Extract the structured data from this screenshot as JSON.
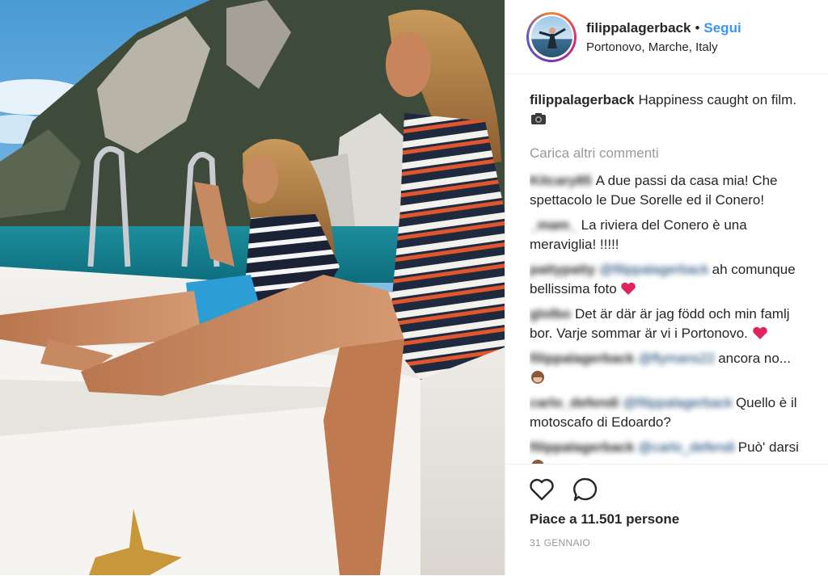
{
  "post": {
    "username": "filippalagerback",
    "follow_label": "Segui",
    "separator": "•",
    "location": "Portonovo, Marche, Italy",
    "caption_text": "Happiness caught on film.",
    "caption_emoji": "camera-icon"
  },
  "comments_section": {
    "load_more": "Carica altri commenti",
    "items": [
      {
        "user": "Kitcary85",
        "mention": "",
        "text": "A due passi da casa mia! Che spettacolo le Due Sorelle ed il Conero!"
      },
      {
        "user": "_mam_",
        "mention": "",
        "text": "La riviera del Conero è una meraviglia! !!!!!"
      },
      {
        "user": "pattypatty",
        "mention": "@filippalagerback",
        "text": "ah comunque bellissima foto",
        "emoji": "heart-icon"
      },
      {
        "user": "glolbo",
        "mention": "",
        "text": "Det är där är jag född och min famlj bor. Varje sommar är vi i Portonovo.",
        "emoji": "heart-icon"
      },
      {
        "user": "filippalagerback",
        "mention": "@flymans22",
        "text": "ancora no...",
        "emoji": "monkey-icon"
      },
      {
        "user": "carlo_defendi",
        "mention": "@filippalagerback",
        "text": "Quello è il motoscafo di Edoardo?"
      },
      {
        "user": "filippalagerback",
        "mention": "@carlo_defendi",
        "text": "Può' darsi",
        "emoji": "monkey-icon"
      }
    ]
  },
  "actions": {
    "like_icon": "heart-outline-icon",
    "comment_icon": "comment-bubble-icon",
    "likes_text": "Piace a 11.501 persone",
    "date": "31 GENNAIO"
  },
  "colors": {
    "link": "#3897f0",
    "muted": "#999999",
    "text": "#262626"
  }
}
